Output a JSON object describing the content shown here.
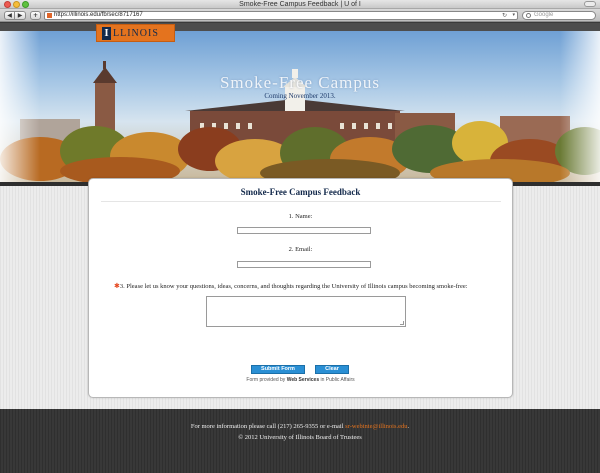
{
  "browser": {
    "window_title": "Smoke-Free Campus Feedback | U of I",
    "url": "https://illinois.edu/fb/sec/8717167",
    "search_placeholder": "Google",
    "back_glyph": "◀",
    "forward_glyph": "▶",
    "add_glyph": "+",
    "reload_glyph": "↻",
    "dropdown_glyph": "▾"
  },
  "banner": {
    "logo_letter": "I",
    "logo_text": "LLINOIS",
    "title": "Smoke-Free Campus",
    "subtitle": "Coming November 2013."
  },
  "form": {
    "title": "Smoke-Free Campus Feedback",
    "q1_label": "1. Name:",
    "q2_label": "2. Email:",
    "q3_required_mark": "✱",
    "q3_label": "3. Please let us know your questions, ideas, concerns, and thoughts regarding the University of Illinois campus becoming smoke-free:",
    "name_value": "",
    "email_value": "",
    "feedback_value": "",
    "submit_label": "Submit Form",
    "clear_label": "Clear",
    "provided_prefix": "Form provided by ",
    "provided_link": "Web Services",
    "provided_suffix": " in Public Affairs"
  },
  "footer": {
    "info_prefix": "For more information please call (217) 265-9355 or e-mail ",
    "email": "sr-webinte@illinois.edu",
    "info_suffix": ".",
    "copyright": "© 2012 University of Illinois Board of Trustees"
  },
  "colors": {
    "illinois_orange": "#e4731e",
    "illinois_blue": "#13294b",
    "button_blue": "#2a8fd4"
  }
}
